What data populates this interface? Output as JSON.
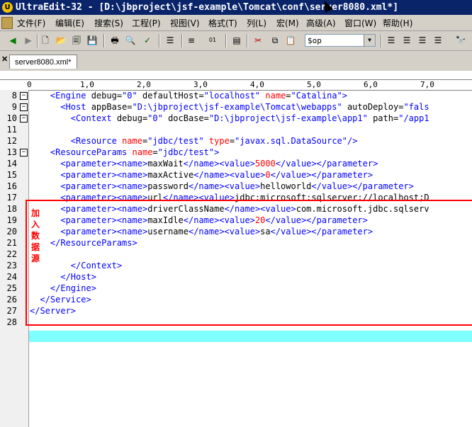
{
  "window": {
    "title": "UltraEdit-32 - [D:\\jbproject\\jsf-example\\Tomcat\\conf\\server8080.xml*]"
  },
  "menu": {
    "items": [
      "文件(F)",
      "编辑(E)",
      "搜索(S)",
      "工程(P)",
      "视图(V)",
      "格式(T)",
      "列(L)",
      "宏(M)",
      "高级(A)",
      "窗口(W)",
      "帮助(H)"
    ]
  },
  "toolbar": {
    "combo_value": "$op"
  },
  "tab": {
    "label": "server8080.xml*"
  },
  "ruler": {
    "labels": [
      "0",
      "1,0",
      "2,0",
      "3,0",
      "4,0",
      "5,0",
      "6,0",
      "7,0"
    ]
  },
  "annotation": {
    "text": [
      "加",
      "入",
      "数",
      "据",
      "源"
    ]
  },
  "lines": [
    {
      "n": "8",
      "fold": "−",
      "html": "    <span class='t-tag'>&lt;Engine</span> debug=<span class='t-tag'>\"0\"</span> defaultHost=<span class='t-tag'>\"localhost\"</span> <span class='t-red'>name</span>=<span class='t-tag'>\"Catalina\"</span><span class='t-tag'>&gt;</span>"
    },
    {
      "n": "9",
      "fold": "−",
      "html": "      <span class='t-tag'>&lt;Host</span> appBase=<span class='t-tag'>\"D:\\jbproject\\jsf-example\\Tomcat\\webapps\"</span> autoDeploy=<span class='t-tag'>\"fals</span>"
    },
    {
      "n": "10",
      "fold": "−",
      "html": "        <span class='t-tag'>&lt;Context</span> debug=<span class='t-tag'>\"0\"</span> docBase=<span class='t-tag'>\"D:\\jbproject\\jsf-example\\app1\"</span> path=<span class='t-tag'>\"/app1</span>"
    },
    {
      "n": "11",
      "fold": "",
      "html": ""
    },
    {
      "n": "12",
      "fold": "",
      "html": "        <span class='t-tag'>&lt;Resource</span> <span class='t-red'>name</span>=<span class='t-tag'>\"jdbc/test\"</span> <span class='t-red'>type</span>=<span class='t-tag'>\"javax.sql.DataSource\"</span><span class='t-tag'>/&gt;</span>"
    },
    {
      "n": "13",
      "fold": "−",
      "html": "    <span class='t-tag'>&lt;ResourceParams</span> <span class='t-red'>name</span>=<span class='t-tag'>\"jdbc/test\"</span><span class='t-tag'>&gt;</span>"
    },
    {
      "n": "14",
      "fold": "",
      "html": "      <span class='t-tag'>&lt;parameter&gt;&lt;name&gt;</span>maxWait<span class='t-tag'>&lt;/name&gt;&lt;value&gt;</span><span class='t-red'>5000</span><span class='t-tag'>&lt;/value&gt;&lt;/parameter&gt;</span>"
    },
    {
      "n": "15",
      "fold": "",
      "html": "      <span class='t-tag'>&lt;parameter&gt;&lt;name&gt;</span>maxActive<span class='t-tag'>&lt;/name&gt;&lt;value&gt;</span><span class='t-red'>0</span><span class='t-tag'>&lt;/value&gt;&lt;/parameter&gt;</span>"
    },
    {
      "n": "16",
      "fold": "",
      "html": "      <span class='t-tag'>&lt;parameter&gt;&lt;name&gt;</span>password<span class='t-tag'>&lt;/name&gt;&lt;value&gt;</span>helloworld<span class='t-tag'>&lt;/value&gt;&lt;/parameter&gt;</span>"
    },
    {
      "n": "17",
      "fold": "",
      "html": "      <span class='t-tag'>&lt;parameter&gt;&lt;name&gt;</span>url<span class='t-tag'>&lt;/name&gt;&lt;value&gt;</span>jdbc:microsoft:sqlserver://localhost;D"
    },
    {
      "n": "18",
      "fold": "",
      "html": "      <span class='t-tag'>&lt;parameter&gt;&lt;name&gt;</span>driverClassName<span class='t-tag'>&lt;/name&gt;&lt;value&gt;</span>com.microsoft.jdbc.sqlserv"
    },
    {
      "n": "19",
      "fold": "",
      "html": "      <span class='t-tag'>&lt;parameter&gt;&lt;name&gt;</span>maxIdle<span class='t-tag'>&lt;/name&gt;&lt;value&gt;</span><span class='t-red'>20</span><span class='t-tag'>&lt;/value&gt;&lt;/parameter&gt;</span>"
    },
    {
      "n": "20",
      "fold": "",
      "html": "      <span class='t-tag'>&lt;parameter&gt;&lt;name&gt;</span>username<span class='t-tag'>&lt;/name&gt;&lt;value&gt;</span>sa<span class='t-tag'>&lt;/value&gt;&lt;/parameter&gt;</span>"
    },
    {
      "n": "21",
      "fold": "",
      "html": "    <span class='t-tag'>&lt;/ResourceParams&gt;</span>"
    },
    {
      "n": "22",
      "fold": "",
      "html": ""
    },
    {
      "n": "23",
      "fold": "",
      "html": "        <span class='t-tag'>&lt;/Context&gt;</span>"
    },
    {
      "n": "24",
      "fold": "",
      "html": "      <span class='t-tag'>&lt;/Host&gt;</span>"
    },
    {
      "n": "25",
      "fold": "",
      "html": "    <span class='t-tag'>&lt;/Engine&gt;</span>"
    },
    {
      "n": "26",
      "fold": "",
      "html": "  <span class='t-tag'>&lt;/Service&gt;</span>"
    },
    {
      "n": "27",
      "fold": "",
      "html": "<span class='t-tag'>&lt;/Server&gt;</span>"
    },
    {
      "n": "28",
      "fold": "",
      "html": ""
    }
  ]
}
